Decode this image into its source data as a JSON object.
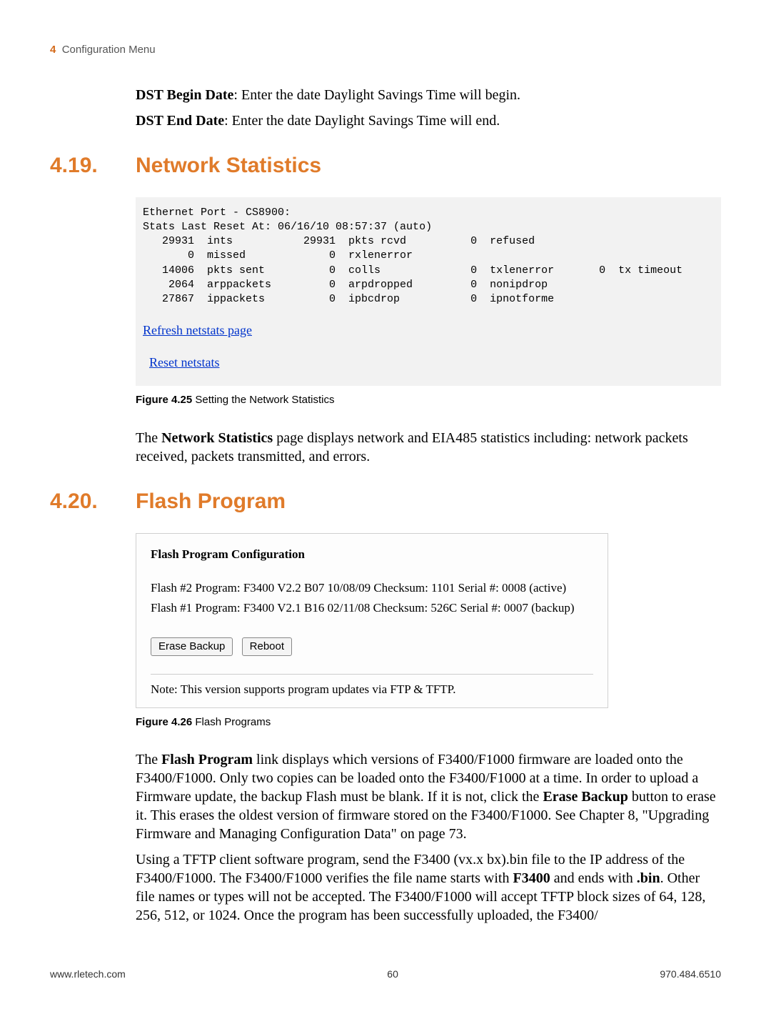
{
  "header": {
    "chapter_number": "4",
    "chapter_title": "Configuration Menu"
  },
  "dst": {
    "begin_label": "DST Begin Date",
    "begin_text": ": Enter the date Daylight Savings Time will begin.",
    "end_label": "DST End Date",
    "end_text": ": Enter the date Daylight Savings Time will end."
  },
  "section_419": {
    "num": "4.19.",
    "title": "Network Statistics",
    "stats_text": "Ethernet Port - CS8900:\nStats Last Reset At: 06/16/10 08:57:37 (auto)\n   29931  ints           29931  pkts rcvd          0  refused\n       0  missed             0  rxlenerror\n   14006  pkts sent          0  colls              0  txlenerror       0  tx timeout\n    2064  arppackets         0  arpdropped         0  nonipdrop\n   27867  ippackets          0  ipbcdrop           0  ipnotforme",
    "refresh_link": "Refresh netstats page",
    "reset_link": "Reset netstats",
    "fig_label": "Figure 4.25",
    "fig_caption": " Setting the Network Statistics",
    "para_pre": "The ",
    "para_bold": "Network Statistics",
    "para_post": " page displays network and EIA485 statistics including: network packets received, packets transmitted, and errors."
  },
  "section_420": {
    "num": "4.20.",
    "title": "Flash Program",
    "box_title": "Flash Program Configuration",
    "flash2": "Flash #2 Program: F3400 V2.2 B07 10/08/09 Checksum: 1101  Serial #: 0008 (active)",
    "flash1": "Flash #1 Program: F3400 V2.1 B16 02/11/08 Checksum: 526C Serial #: 0007 (backup)",
    "erase_btn": "Erase Backup",
    "reboot_btn": "Reboot",
    "note": "Note: This version supports program updates via FTP & TFTP.",
    "fig_label": "Figure 4.26",
    "fig_caption": " Flash Programs",
    "p1_a": "The ",
    "p1_b": "Flash Program",
    "p1_c": " link displays which versions of F3400/F1000 firmware are loaded onto the F3400/F1000. Only two copies can be loaded onto the F3400/F1000 at a time. In order to upload a Firmware update, the backup Flash must be blank. If it is not, click the ",
    "p1_d": "Erase Backup",
    "p1_e": " button to erase it. This erases the oldest version of firmware stored on the F3400/F1000. See Chapter 8, \"Upgrading Firmware and Managing Configuration Data\" on page 73.",
    "p2_a": "Using a TFTP client software program, send the F3400 (vx.x bx).bin file to the IP address of the F3400/F1000. The F3400/F1000 verifies the file name starts with ",
    "p2_b": "F3400",
    "p2_c": " and ends with ",
    "p2_d": ".bin",
    "p2_e": ". Other file names or types will not be accepted. The F3400/F1000 will accept TFTP block sizes of 64, 128, 256, 512, or 1024. Once the program has been successfully uploaded, the F3400/"
  },
  "footer": {
    "left": "www.rletech.com",
    "center": "60",
    "right": "970.484.6510"
  }
}
